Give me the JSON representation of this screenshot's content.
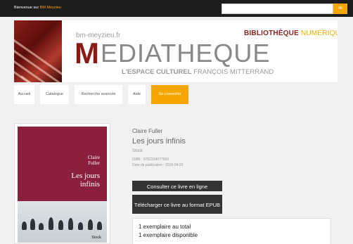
{
  "topbar": {
    "welcome_prefix": "Bienvenue sur",
    "welcome_user": "BM Meyzieu",
    "search_placeholder": "",
    "search_button": "ok"
  },
  "banner": {
    "url": "bm-meyzieu.fr",
    "lib_part1": "BIBLIOTHÈQUE",
    "lib_part2": "NUMÉRIQUE",
    "media_first": "M",
    "media_rest": "EDIATHEQUE",
    "espace_bold": "L'ESPACE CULTUREL",
    "espace_rest": "FRANÇOIS MITTERRAND"
  },
  "nav": [
    {
      "label": "Accueil"
    },
    {
      "label": "Catalogue"
    },
    {
      "label": "Recherche avancée"
    },
    {
      "label": "Aide"
    },
    {
      "label": "Se connecter"
    }
  ],
  "book": {
    "author": "Claire Fuller",
    "title": "Les jours infinis",
    "publisher": "Stock",
    "isbn": "ISBN : 9782234077560",
    "pubdate": "Date de publication : 2015-04-29",
    "cover_author_line1": "Claire",
    "cover_author_line2": "Fuller",
    "cover_title_line1": "Les jours",
    "cover_title_line2": "infinis",
    "cover_publisher": "Stock"
  },
  "actions": {
    "read_online": "Consulter ce livre en ligne",
    "download": "Télécharger ce livre au format EPUB"
  },
  "availability": {
    "total": "1 exemplaire au total",
    "available": "1 exemplaire disponible"
  },
  "colors": {
    "accent": "#f7a500",
    "brand_red": "#8a1a17",
    "dark": "#333333"
  }
}
